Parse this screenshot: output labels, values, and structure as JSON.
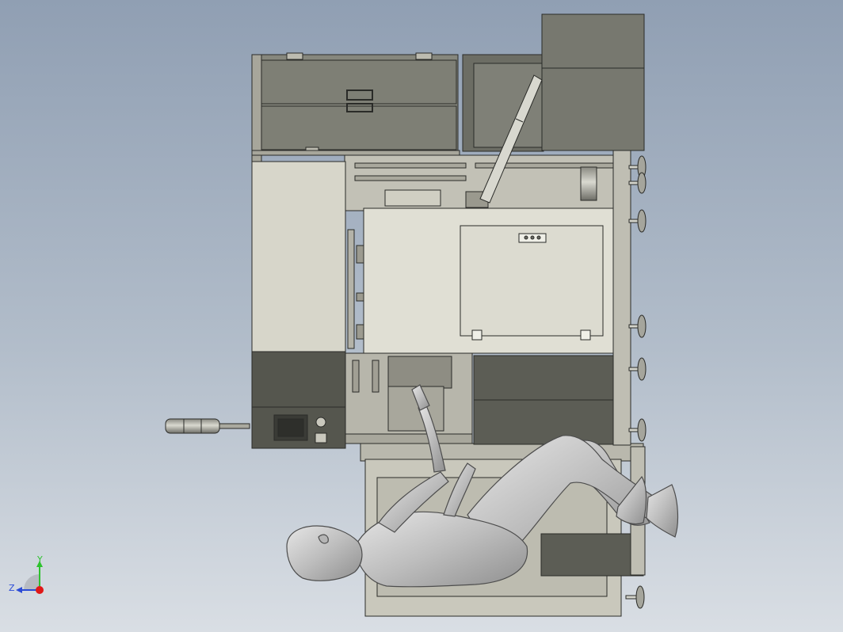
{
  "view": {
    "background_top": "#909fb3",
    "background_bottom": "#d9dee4"
  },
  "triad": {
    "y_label": "Y",
    "z_label": "Z",
    "y_color": "#2ec22e",
    "z_color": "#2b4bd6",
    "x_color": "#e01818"
  },
  "colors": {
    "enclosure_dark": "#5c5d55",
    "enclosure_mid": "#86877d",
    "panel_light": "#d7d6ca",
    "panel_lighter": "#e2e1d6",
    "frame_edge": "#2a2b28",
    "mannequin": "#c6c6c6"
  },
  "icons": {
    "view_triad": "axis-triad-icon",
    "signal_tower": "signal-light-tower-icon",
    "hmi_screen": "touch-panel-icon"
  }
}
